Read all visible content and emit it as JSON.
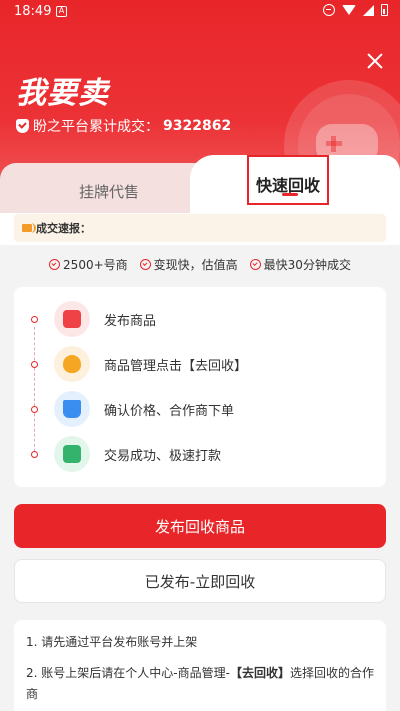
{
  "status_bar": {
    "time": "18:49",
    "app_badge": "A"
  },
  "header": {
    "title": "我要卖",
    "stat_label": "盼之平台累计成交：",
    "stat_value": "9322862"
  },
  "tabs": [
    {
      "label": "挂牌代售",
      "active": false
    },
    {
      "label": "快速回收",
      "active": true
    }
  ],
  "news": {
    "label": "成交速报："
  },
  "features": [
    "2500+号商",
    "变现快，估值高",
    "最快30分钟成交"
  ],
  "steps": [
    {
      "label": "发布商品",
      "icon": "publish-bag-icon"
    },
    {
      "label": "商品管理点击【去回收】",
      "icon": "money-bag-icon"
    },
    {
      "label": "确认价格、合作商下单",
      "icon": "cart-icon"
    },
    {
      "label": "交易成功、极速打款",
      "icon": "wallet-check-icon"
    }
  ],
  "buttons": {
    "primary": "发布回收商品",
    "secondary": "已发布-立即回收"
  },
  "notes": {
    "note1": "1. 请先通过平台发布账号并上架",
    "note2_prefix": "2. 账号上架后请在个人中心-商品管理-",
    "note2_bold": "【去回收】",
    "note2_suffix": "选择回收的合作商"
  },
  "colors": {
    "brand_red": "#e8262a"
  }
}
